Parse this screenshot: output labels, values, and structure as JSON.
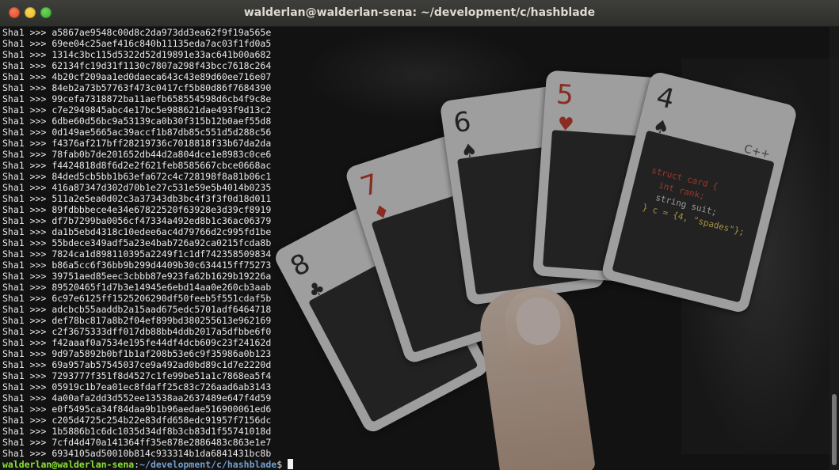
{
  "window": {
    "title": "walderlan@walderlan-sena: ~/development/c/hashblade"
  },
  "terminal": {
    "lines": [
      {
        "label": "Sha1 >>> ",
        "hash": "a5867ae9548c00d8c2da973dd3ea62f9f19a565e"
      },
      {
        "label": "Sha1 >>> ",
        "hash": "69ee04c25aef416c840b11135eda7ac03f1fd0a5"
      },
      {
        "label": "Sha1 >>> ",
        "hash": "1314c3bc115d5322d52d19891e33ac641b00a682"
      },
      {
        "label": "Sha1 >>> ",
        "hash": "62134fc19d31f1130c7807a298f43bcc7618c264"
      },
      {
        "label": "Sha1 >>> ",
        "hash": "4b20cf209aa1ed0daeca643c43e89d60ee716e07"
      },
      {
        "label": "Sha1 >>> ",
        "hash": "84eb2a73b57763f473c0417cf5b80d86f7684390"
      },
      {
        "label": "Sha1 >>> ",
        "hash": "99cefa7318872ba11aefb658554598d6cb4f9c8e"
      },
      {
        "label": "Sha1 >>> ",
        "hash": "c7e2949845abc4e17bc5e988621dae493f9d13c2"
      },
      {
        "label": "Sha1 >>> ",
        "hash": "6dbe60d56bc9a53139ca0b30f315b12b0aef55d8"
      },
      {
        "label": "Sha1 >>> ",
        "hash": "0d149ae5665ac39accf1b87db85c551d5d288c56"
      },
      {
        "label": "Sha1 >>> ",
        "hash": "f4376af217bff28219736c7018818f33b67da2da"
      },
      {
        "label": "Sha1 >>> ",
        "hash": "78fab0b7de201652db44d2a804dce1e8983c0ce6"
      },
      {
        "label": "Sha1 >>> ",
        "hash": "f4424818d8f6d2e2f621feb8585667cbce0668ac"
      },
      {
        "label": "Sha1 >>> ",
        "hash": "84ded5cb5bb1b63efa672c4c728198f8a81b06c1"
      },
      {
        "label": "Sha1 >>> ",
        "hash": "416a87347d302d70b1e27c531e59e5b4014b0235"
      },
      {
        "label": "Sha1 >>> ",
        "hash": "511a2e5ea0d02c3a37343db3bc4f3f3f0d18d011"
      },
      {
        "label": "Sha1 >>> ",
        "hash": "89fdbbbece4e34e67822520f63928e3d39cf8919"
      },
      {
        "label": "Sha1 >>> ",
        "hash": "df7b7299ba0056cf47334a492ed8b1c36ac06379"
      },
      {
        "label": "Sha1 >>> ",
        "hash": "da1b5ebd4318c10edee6ac4d79766d2c995fd1be"
      },
      {
        "label": "Sha1 >>> ",
        "hash": "55bdece349adf5a23e4bab726a92ca0215fcda8b"
      },
      {
        "label": "Sha1 >>> ",
        "hash": "7824ca1d898110395a2249f1c1df742358509834"
      },
      {
        "label": "Sha1 >>> ",
        "hash": "b86a5cc6f36bb9b299d4409b30c634415ff75273"
      },
      {
        "label": "Sha1 >>> ",
        "hash": "39751aed85eec3cbbb87e923fa62b1629b19226a"
      },
      {
        "label": "Sha1 >>> ",
        "hash": "89520465f1d7b3e14945e6ebd14aa0e260cb3aab"
      },
      {
        "label": "Sha1 >>> ",
        "hash": "6c97e6125ff1525206290df50feeb5f551cdaf5b"
      },
      {
        "label": "Sha1 >>> ",
        "hash": "adcbcb55aaddb2a15aad675edc5701adf6464718"
      },
      {
        "label": "Sha1 >>> ",
        "hash": "def78bc817a8b2f04ef899bd380255613e962169"
      },
      {
        "label": "Sha1 >>> ",
        "hash": "c2f3675333dff017db88bb4ddb2017a5dfbbe6f0"
      },
      {
        "label": "Sha1 >>> ",
        "hash": "f42aaaf0a7534e195fe44df4dcb609c23f24162d"
      },
      {
        "label": "Sha1 >>> ",
        "hash": "9d97a5892b0bf1b1af208b53e6c9f35986a0b123"
      },
      {
        "label": "Sha1 >>> ",
        "hash": "69a957ab57545037ce9a492ad0bd89c1d7e2220d"
      },
      {
        "label": "Sha1 >>> ",
        "hash": "7293777f351f8d4527c1fe99be51a1c7868ea5f4"
      },
      {
        "label": "Sha1 >>> ",
        "hash": "05919c1b7ea01ec8fdaff25c83c726aad6ab3143"
      },
      {
        "label": "Sha1 >>> ",
        "hash": "4a00afa2dd3d552ee13538aa2637489e647f4d59"
      },
      {
        "label": "Sha1 >>> ",
        "hash": "e0f5495ca34f84daa9b1b96aedae516900061ed6"
      },
      {
        "label": "Sha1 >>> ",
        "hash": "c205d4725c254b22e83dfd658edc91957f7156dc"
      },
      {
        "label": "Sha1 >>> ",
        "hash": "1b5886b1c6dc1035d34df8b3cb83d1f55741018d"
      },
      {
        "label": "Sha1 >>> ",
        "hash": "7cfd4d470a141364ff35e878e2886483c863e1e7"
      },
      {
        "label": "Sha1 >>> ",
        "hash": "6934105ad50010b814c933314b1da6841431bc8b"
      }
    ],
    "prompt": {
      "user": "walderlan@walderlan-sena",
      "sep": ":",
      "path": "~/development/c/hashblade",
      "symbol": "$ "
    }
  },
  "wallpaper": {
    "cards": [
      {
        "rank": "8",
        "suit": "♣",
        "red": false,
        "code": ""
      },
      {
        "rank": "7",
        "suit": "♦",
        "red": true,
        "code": ""
      },
      {
        "rank": "6",
        "suit": "♠",
        "red": false,
        "code": ""
      },
      {
        "rank": "5",
        "suit": "♥",
        "red": true,
        "code": ""
      },
      {
        "rank": "4",
        "suit": "♠",
        "red": false,
        "code_lines": [
          "struct card {",
          "  int rank;",
          "  string suit;",
          "} c = {4, \"spades\"};"
        ],
        "corner": "C++"
      }
    ]
  },
  "colors": {
    "prompt_user": "#8ae234",
    "prompt_path": "#729fcf",
    "text": "#e8e8e8"
  }
}
